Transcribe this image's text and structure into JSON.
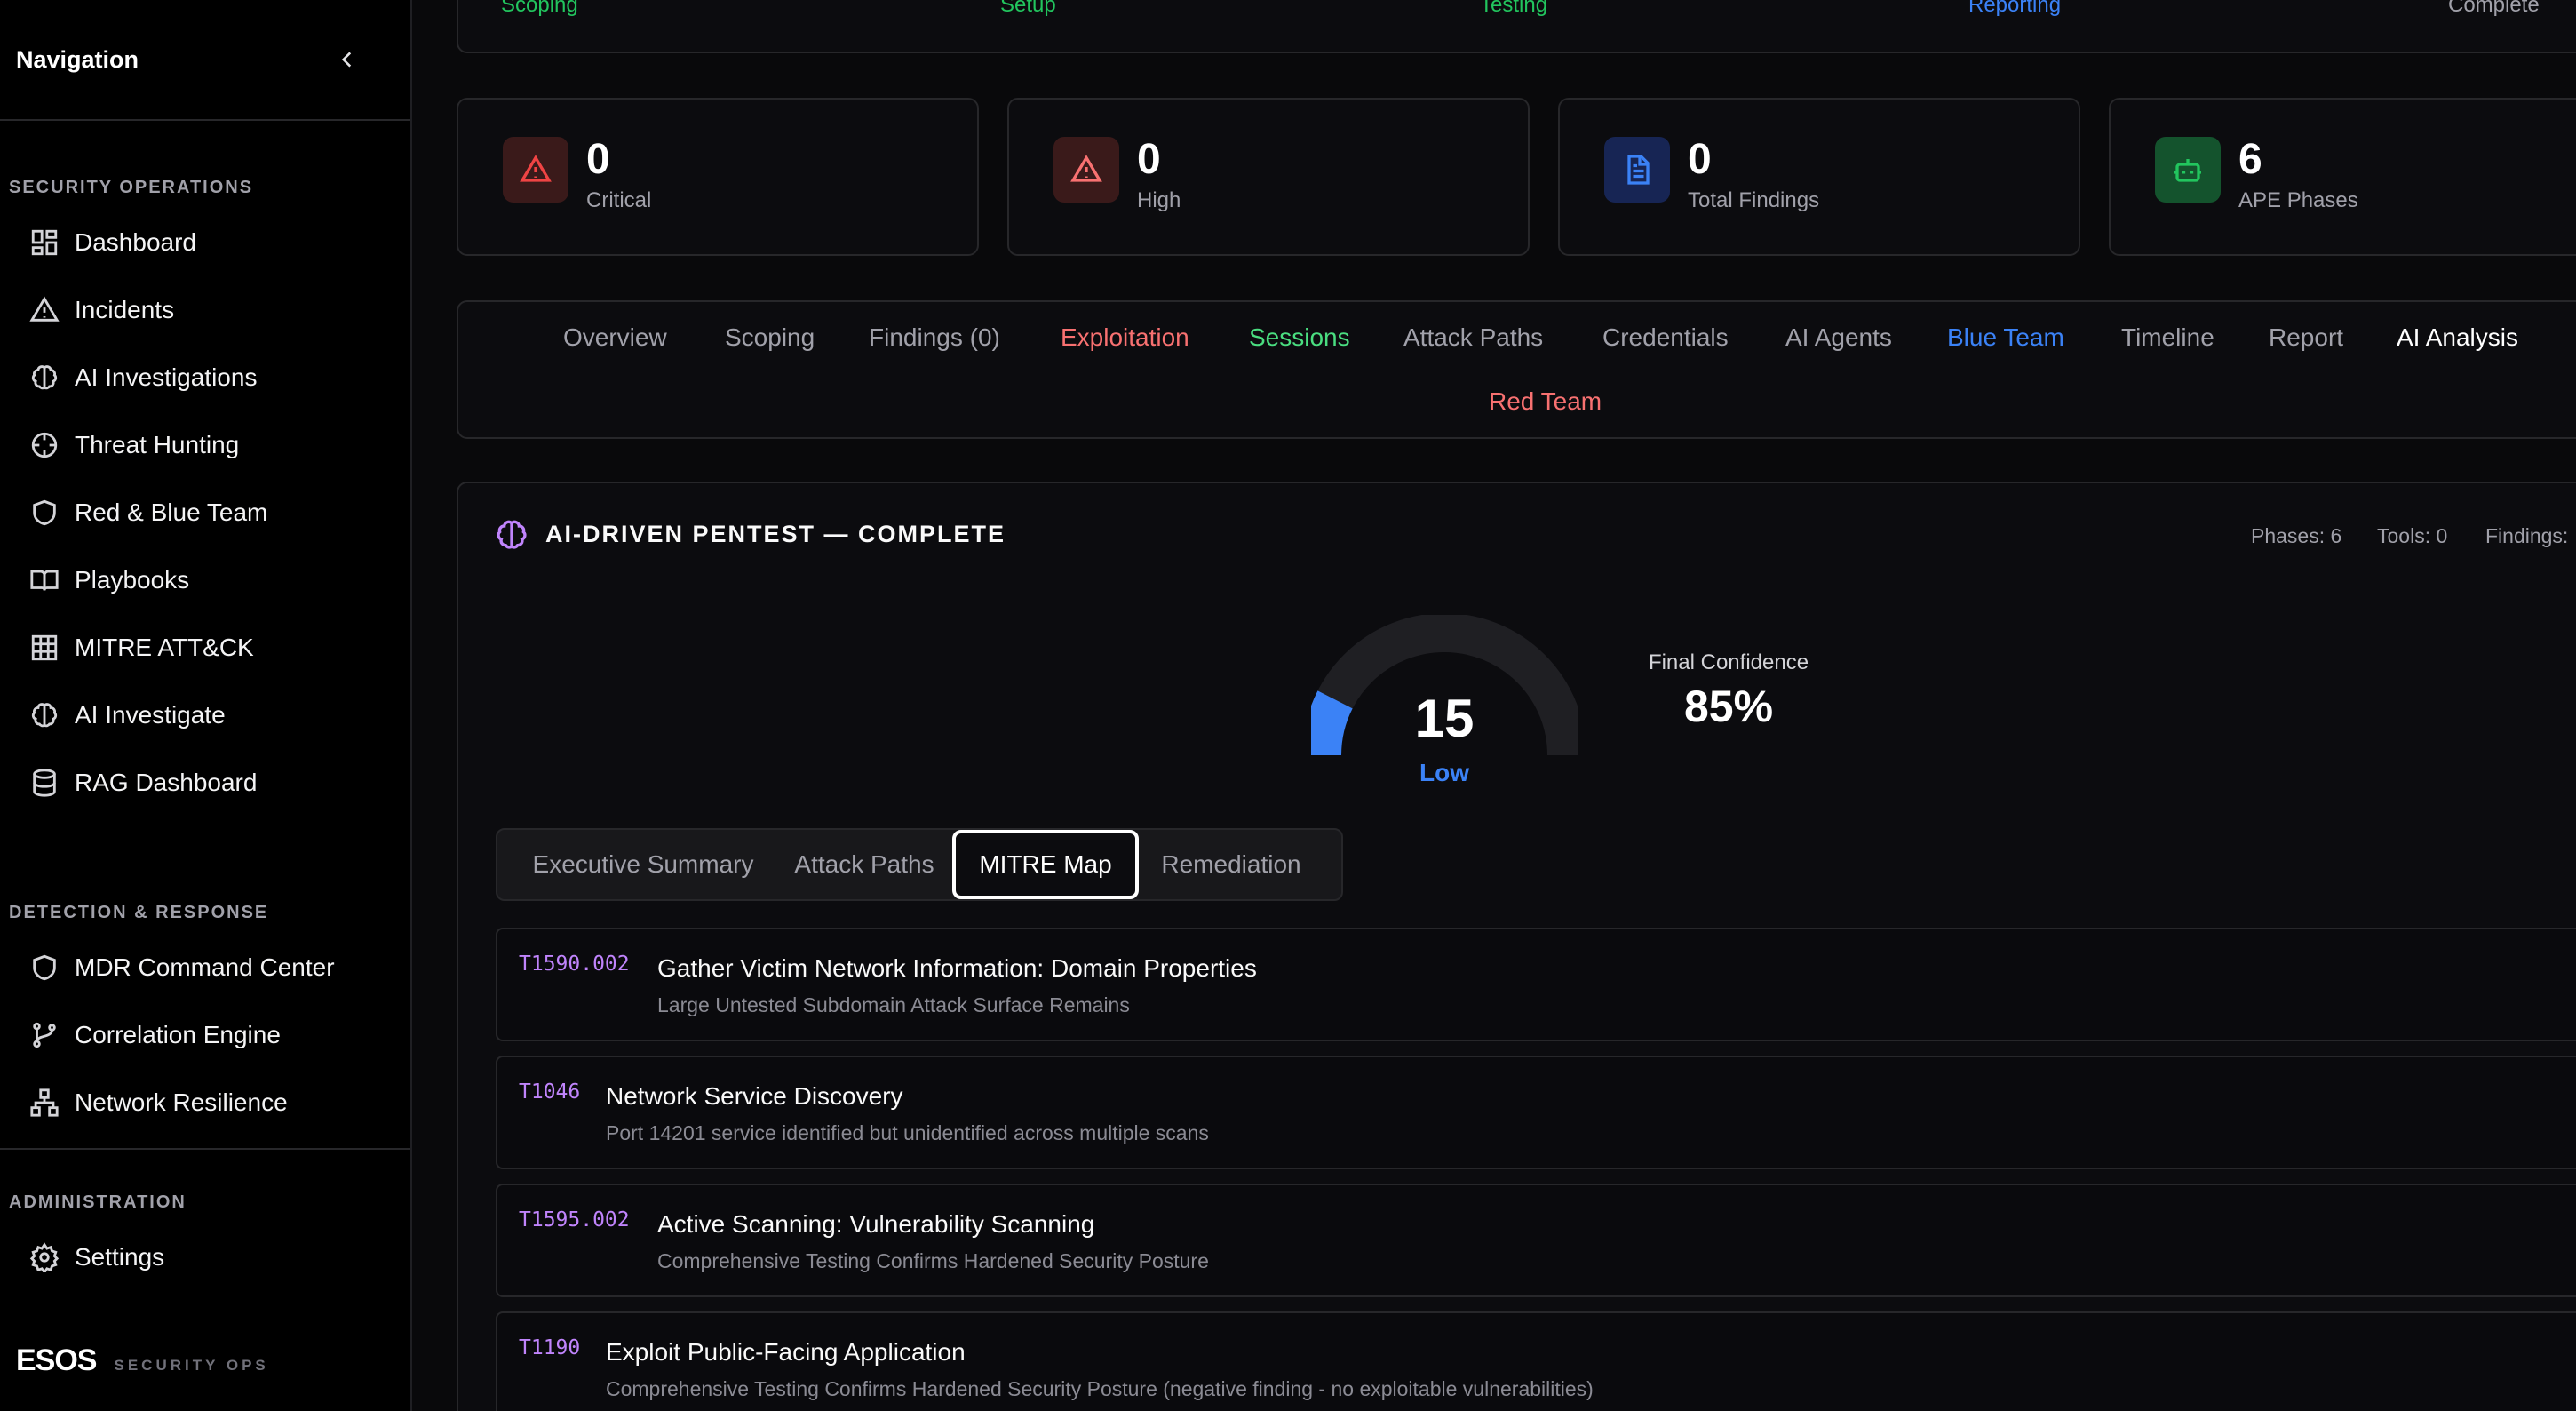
{
  "sidebar": {
    "title": "Navigation",
    "sections": [
      {
        "title": "SECURITY OPERATIONS",
        "items": [
          {
            "label": "Dashboard",
            "icon": "dashboard-icon"
          },
          {
            "label": "Incidents",
            "icon": "alert-triangle-icon"
          },
          {
            "label": "AI Investigations",
            "icon": "brain-icon"
          },
          {
            "label": "Threat Hunting",
            "icon": "crosshair-icon"
          },
          {
            "label": "Red & Blue Team",
            "icon": "shield-icon"
          },
          {
            "label": "Playbooks",
            "icon": "book-icon"
          },
          {
            "label": "MITRE ATT&CK",
            "icon": "grid-icon"
          },
          {
            "label": "AI Investigate",
            "icon": "brain-icon"
          },
          {
            "label": "RAG Dashboard",
            "icon": "database-icon"
          }
        ]
      },
      {
        "title": "DETECTION & RESPONSE",
        "items": [
          {
            "label": "MDR Command Center",
            "icon": "shield-icon"
          },
          {
            "label": "Correlation Engine",
            "icon": "git-branch-icon"
          },
          {
            "label": "Network Resilience",
            "icon": "network-icon"
          }
        ]
      },
      {
        "title": "ADMINISTRATION",
        "items": [
          {
            "label": "Settings",
            "icon": "gear-icon"
          }
        ]
      }
    ],
    "brand": {
      "logo": "ESOS",
      "subtitle": "SECURITY OPS"
    }
  },
  "phases": [
    {
      "label": "Scoping",
      "color": "#22c55e"
    },
    {
      "label": "Setup",
      "color": "#22c55e"
    },
    {
      "label": "Testing",
      "color": "#22c55e"
    },
    {
      "label": "Reporting",
      "color": "#3b82f6"
    },
    {
      "label": "Complete",
      "color": "#a1a1aa"
    }
  ],
  "stats": [
    {
      "value": "0",
      "label": "Critical",
      "icon": "alert-triangle-icon",
      "color": "#ef4444",
      "bg": "#3a1a1a"
    },
    {
      "value": "0",
      "label": "High",
      "icon": "alert-triangle-icon",
      "color": "#f87171",
      "bg": "#3a1a1a"
    },
    {
      "value": "0",
      "label": "Total Findings",
      "icon": "file-text-icon",
      "color": "#3b82f6",
      "bg": "#172554"
    },
    {
      "value": "6",
      "label": "APE Phases",
      "icon": "bot-icon",
      "color": "#22c55e",
      "bg": "#14532d"
    }
  ],
  "tabs": [
    {
      "label": "Overview",
      "color": "#a1a1aa"
    },
    {
      "label": "Scoping",
      "color": "#a1a1aa"
    },
    {
      "label": "Findings (0)",
      "color": "#a1a1aa"
    },
    {
      "label": "Exploitation",
      "color": "#f87171"
    },
    {
      "label": "Sessions",
      "color": "#4ade80"
    },
    {
      "label": "Attack Paths",
      "color": "#a1a1aa"
    },
    {
      "label": "Credentials",
      "color": "#a1a1aa"
    },
    {
      "label": "AI Agents",
      "color": "#a1a1aa"
    },
    {
      "label": "Blue Team",
      "color": "#3b82f6"
    },
    {
      "label": "Timeline",
      "color": "#a1a1aa"
    },
    {
      "label": "Report",
      "color": "#a1a1aa"
    },
    {
      "label": "AI Analysis",
      "color": "#ffffff"
    },
    {
      "label": "Red Team",
      "color": "#f87171"
    }
  ],
  "analysis": {
    "title": "AI-DRIVEN PENTEST — COMPLETE",
    "meta": {
      "phases": "Phases: 6",
      "tools": "Tools: 0",
      "findings": "Findings:"
    },
    "risk_score": "15",
    "risk_level": "Low",
    "risk_fraction": 0.15,
    "confidence_label": "Final Confidence",
    "confidence_value": "85%",
    "subtabs": [
      "Executive Summary",
      "Attack Paths",
      "MITRE Map",
      "Remediation"
    ],
    "active_subtab": "MITRE Map",
    "techniques": [
      {
        "id": "T1590.002",
        "name": "Gather Victim Network Information: Domain Properties",
        "desc": "Large Untested Subdomain Attack Surface Remains"
      },
      {
        "id": "T1046",
        "name": "Network Service Discovery",
        "desc": "Port 14201 service identified but unidentified across multiple scans"
      },
      {
        "id": "T1595.002",
        "name": "Active Scanning: Vulnerability Scanning",
        "desc": "Comprehensive Testing Confirms Hardened Security Posture"
      },
      {
        "id": "T1190",
        "name": "Exploit Public-Facing Application",
        "desc": "Comprehensive Testing Confirms Hardened Security Posture (negative finding - no exploitable vulnerabilities)"
      }
    ]
  }
}
